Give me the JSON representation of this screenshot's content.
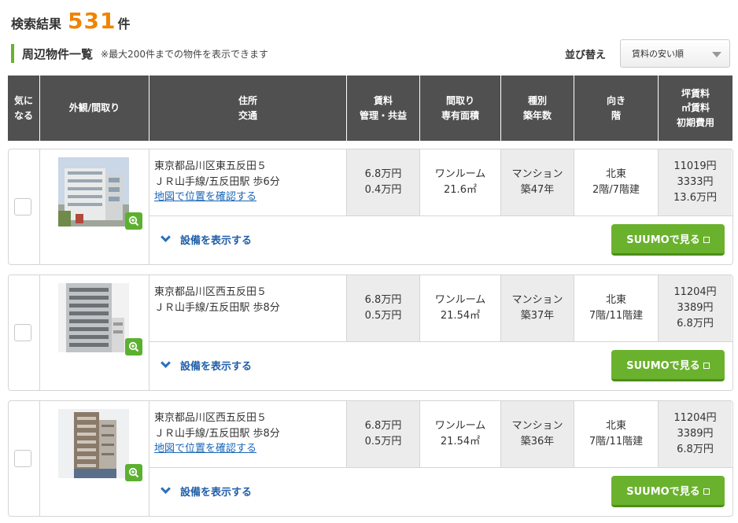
{
  "result": {
    "label": "検索結果",
    "count": "531",
    "unit": "件"
  },
  "section": {
    "title": "周辺物件一覧",
    "note": "※最大200件までの物件を表示できます"
  },
  "sort": {
    "label": "並び替え",
    "selected": "賃料の安い順"
  },
  "headers": [
    "気に\nなる",
    "外観/間取り",
    "住所\n交通",
    "賃料\n管理・共益",
    "間取り\n専有面積",
    "種別\n築年数",
    "向き\n階",
    "坪賃料\n㎡賃料\n初期費用"
  ],
  "colors": {
    "accent_green": "#6ab22d",
    "count_orange": "#f08300",
    "header_bg": "#505050",
    "link_blue": "#1a66b8"
  },
  "listings": [
    {
      "address": "東京都品川区東五反田５",
      "transit": "ＪＲ山手線/五反田駅 歩6分",
      "map_link": "地図で位置を確認する",
      "rent": "6.8万円",
      "fee": "0.4万円",
      "layout": "ワンルーム",
      "area": "21.6㎡",
      "type": "マンション",
      "age": "築47年",
      "direction": "北東",
      "floor": "2階/7階建",
      "tsubo_rent": "11019円",
      "sqm_rent": "3333円",
      "initial_cost": "13.6万円",
      "equip_label": "設備を表示する",
      "suumo_label": "SUUMOで見る"
    },
    {
      "address": "東京都品川区西五反田５",
      "transit": "ＪＲ山手線/五反田駅 歩8分",
      "map_link": "",
      "rent": "6.8万円",
      "fee": "0.5万円",
      "layout": "ワンルーム",
      "area": "21.54㎡",
      "type": "マンション",
      "age": "築37年",
      "direction": "北東",
      "floor": "7階/11階建",
      "tsubo_rent": "11204円",
      "sqm_rent": "3389円",
      "initial_cost": "6.8万円",
      "equip_label": "設備を表示する",
      "suumo_label": "SUUMOで見る"
    },
    {
      "address": "東京都品川区西五反田５",
      "transit": "ＪＲ山手線/五反田駅 歩8分",
      "map_link": "地図で位置を確認する",
      "rent": "6.8万円",
      "fee": "0.5万円",
      "layout": "ワンルーム",
      "area": "21.54㎡",
      "type": "マンション",
      "age": "築36年",
      "direction": "北東",
      "floor": "7階/11階建",
      "tsubo_rent": "11204円",
      "sqm_rent": "3389円",
      "initial_cost": "6.8万円",
      "equip_label": "設備を表示する",
      "suumo_label": "SUUMOで見る"
    }
  ]
}
